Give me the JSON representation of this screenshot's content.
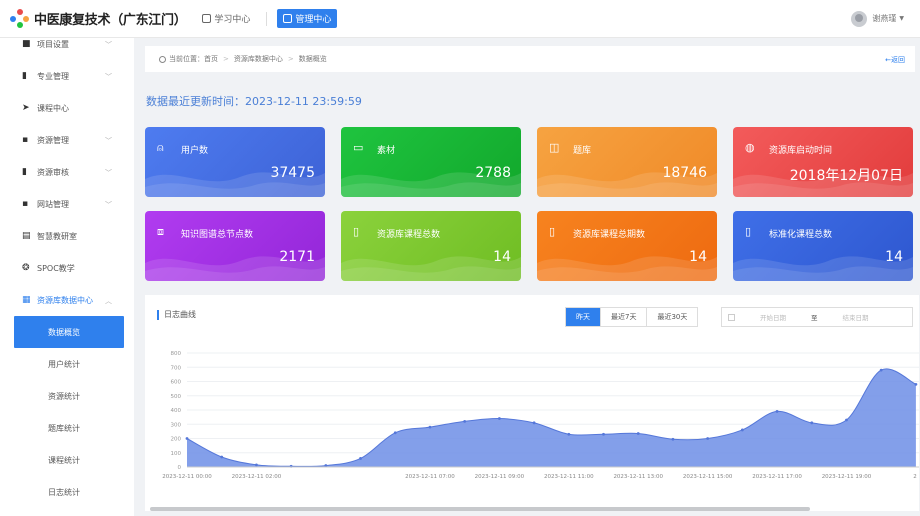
{
  "header": {
    "brand": "中医康复技术（广东江门）",
    "nav": [
      {
        "label": "学习中心",
        "active": false
      },
      {
        "label": "管理中心",
        "active": true
      }
    ],
    "user_name": "谢燕瑾"
  },
  "sidebar": {
    "items": [
      {
        "label": "项目设置",
        "icon": "settings-icon",
        "glyph": "■",
        "expandable": true
      },
      {
        "label": "专业管理",
        "icon": "chart-icon",
        "glyph": "▮",
        "expandable": true
      },
      {
        "label": "课程中心",
        "icon": "send-icon",
        "glyph": "➤",
        "expandable": false
      },
      {
        "label": "资源管理",
        "icon": "lock-icon",
        "glyph": "▪",
        "expandable": true
      },
      {
        "label": "资源审核",
        "icon": "audit-icon",
        "glyph": "▮",
        "expandable": true
      },
      {
        "label": "网站管理",
        "icon": "monitor-icon",
        "glyph": "▪",
        "expandable": true
      },
      {
        "label": "智慧教研室",
        "icon": "book-icon",
        "glyph": "▤",
        "expandable": false
      },
      {
        "label": "SPOC教学",
        "icon": "compass-icon",
        "glyph": "❂",
        "expandable": false
      },
      {
        "label": "资源库数据中心",
        "icon": "database-icon",
        "glyph": "▦",
        "expandable": true,
        "open": true
      }
    ],
    "sub_items": [
      {
        "label": "数据概览",
        "active": true
      },
      {
        "label": "用户统计",
        "active": false
      },
      {
        "label": "资源统计",
        "active": false
      },
      {
        "label": "题库统计",
        "active": false
      },
      {
        "label": "课程统计",
        "active": false
      },
      {
        "label": "日志统计",
        "active": false
      }
    ]
  },
  "breadcrumb": {
    "prefix": "当前位置",
    "items": [
      "首页",
      "资源库数据中心",
      "数据概览"
    ],
    "back": "←返回"
  },
  "update_time": {
    "label": "数据最近更新时间：",
    "value": "2023-12-11 23:59:59"
  },
  "stats": [
    {
      "title": "用户数",
      "value": "37475",
      "icon": "user-icon",
      "glyph": "⍝",
      "color_a": "#4e7cf0",
      "color_b": "#3d62d6"
    },
    {
      "title": "素材",
      "value": "2788",
      "icon": "folder-icon",
      "glyph": "▭",
      "color_a": "#1fc43f",
      "color_b": "#12a82c"
    },
    {
      "title": "题库",
      "value": "18746",
      "icon": "question-icon",
      "glyph": "◫",
      "color_a": "#f6a341",
      "color_b": "#f08a28"
    },
    {
      "title": "资源库启动时间",
      "value": "2018年12月07日",
      "icon": "globe-icon",
      "glyph": "◍",
      "color_a": "#f35b5b",
      "color_b": "#e23c3c"
    },
    {
      "title": "知识图谱总节点数",
      "value": "2171",
      "icon": "graph-icon",
      "glyph": "⧈",
      "color_a": "#b13cf0",
      "color_b": "#9326d8"
    },
    {
      "title": "资源库课程总数",
      "value": "14",
      "icon": "course-icon",
      "glyph": "▯",
      "color_a": "#8bd23c",
      "color_b": "#6fbd23"
    },
    {
      "title": "资源库课程总期数",
      "value": "14",
      "icon": "term-icon",
      "glyph": "▯",
      "color_a": "#f7831f",
      "color_b": "#ee6a10"
    },
    {
      "title": "标准化课程总数",
      "value": "14",
      "icon": "standard-icon",
      "glyph": "▯",
      "color_a": "#3f6fe8",
      "color_b": "#2e57cf"
    }
  ],
  "chart_panel": {
    "title": "日志曲线",
    "ranges": [
      {
        "label": "昨天",
        "active": true
      },
      {
        "label": "最近7天",
        "active": false
      },
      {
        "label": "最近30天",
        "active": false
      }
    ],
    "start_placeholder": "开始日期",
    "to": "至",
    "end_placeholder": "结束日期"
  },
  "chart_data": {
    "type": "area",
    "title": "",
    "xlabel": "",
    "ylabel": "",
    "ylim": [
      0,
      800
    ],
    "yticks": [
      0,
      100,
      200,
      300,
      400,
      500,
      600,
      700,
      800
    ],
    "x": [
      "2023-12-11 00:00",
      "2023-12-11 01:00",
      "2023-12-11 02:00",
      "2023-12-11 03:00",
      "2023-12-11 04:00",
      "2023-12-11 05:00",
      "2023-12-11 06:00",
      "2023-12-11 07:00",
      "2023-12-11 08:00",
      "2023-12-11 09:00",
      "2023-12-11 10:00",
      "2023-12-11 11:00",
      "2023-12-11 12:00",
      "2023-12-11 13:00",
      "2023-12-11 14:00",
      "2023-12-11 15:00",
      "2023-12-11 16:00",
      "2023-12-11 17:00",
      "2023-12-11 18:00",
      "2023-12-11 19:00",
      "2023-12-11 20:00",
      "2023-12-11 21:00"
    ],
    "xtick_labels": [
      "2023-12-11 00:00",
      "2023-12-11 02:00",
      "2023-12-11 07:00",
      "2023-12-11 09:00",
      "2023-12-11 11:00",
      "2023-12-11 13:00",
      "2023-12-11 15:00",
      "2023-12-11 17:00",
      "2023-12-11 19:00",
      "2"
    ],
    "series": [
      {
        "values": [
          200,
          70,
          15,
          5,
          10,
          60,
          240,
          280,
          320,
          340,
          310,
          230,
          230,
          235,
          195,
          200,
          260,
          390,
          310,
          330,
          680,
          580
        ]
      }
    ],
    "grid": true,
    "color": "#6d8ee6"
  }
}
